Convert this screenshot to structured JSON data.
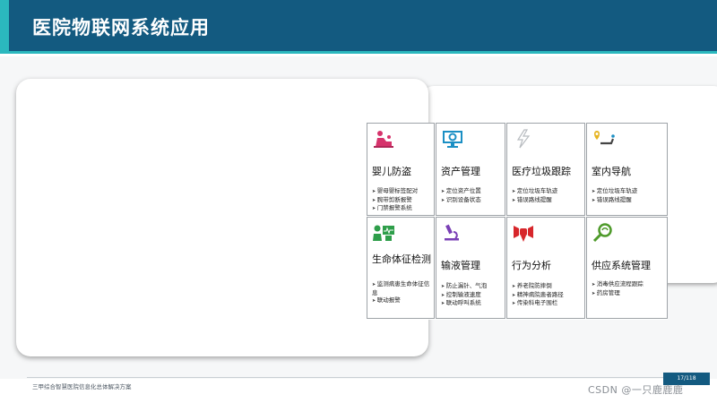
{
  "slide": {
    "title": "医院物联网系统应用",
    "footer": "三甲综合智慧医院信息化总体解决方案",
    "page": "17/118",
    "watermark": "CSDN @一只鹿鹿鹿"
  },
  "tiles": [
    {
      "name": "婴儿防盗",
      "icon": "baby-care-icon",
      "color": "#d6336c",
      "items": [
        "婴母婴标签配对",
        "腕带剪断报警",
        "门禁报警系统"
      ]
    },
    {
      "name": "资产管理",
      "icon": "monitor-gear-icon",
      "color": "#1b8fc4",
      "items": [
        "定位资产位置",
        "识别设备状态"
      ]
    },
    {
      "name": "医疗垃圾跟踪",
      "icon": "lightning-icon",
      "color": "#b8bcc0",
      "items": [
        "定位垃圾车轨迹",
        "错误路线提醒"
      ]
    },
    {
      "name": "室内导航",
      "icon": "navigation-pin-icon",
      "color": "#e6b422",
      "items": [
        "定位垃圾车轨迹",
        "错误路线提醒"
      ]
    },
    {
      "name": "生命体征检测",
      "icon": "vital-monitor-icon",
      "color": "#2e9e4a",
      "items": [
        "监测病患生命体征信息",
        "联动报警"
      ]
    },
    {
      "name": "输液管理",
      "icon": "microscope-icon",
      "color": "#7a3fb5",
      "items": [
        "防止漏针、气泡",
        "控制输液速度",
        "联动呼叫系统"
      ]
    },
    {
      "name": "行为分析",
      "icon": "behavior-icon",
      "color": "#d7262b",
      "items": [
        "养老院防摔倒",
        "精神病院患者路径",
        "传染科电子围栏"
      ]
    },
    {
      "name": "供应系统管理",
      "icon": "magnifier-icon",
      "color": "#4e9a2a",
      "items": [
        "消毒供应流程跟踪",
        "药房管理"
      ]
    }
  ]
}
